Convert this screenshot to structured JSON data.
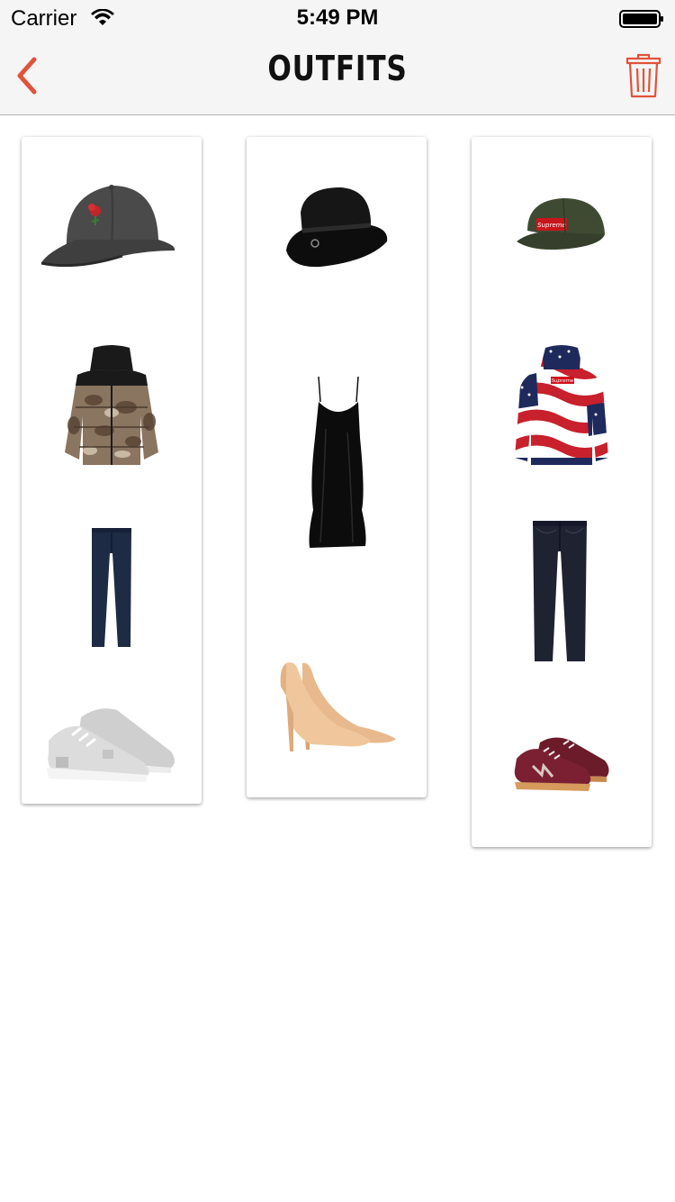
{
  "status_bar": {
    "carrier": "Carrier",
    "time": "5:49 PM"
  },
  "nav": {
    "title": "OUTFITS",
    "back_icon": "chevron-left-icon",
    "delete_icon": "trash-icon"
  },
  "colors": {
    "accent": "#e0533a",
    "bar_background": "#f5f5f5"
  },
  "outfits": [
    {
      "items": [
        "rose-embroidered-cap",
        "puffer-jacket",
        "navy-pants",
        "grey-sneakers"
      ]
    },
    {
      "items": [
        "black-wide-brim-hat",
        "black-slip-dress",
        "nude-heels"
      ]
    },
    {
      "items": [
        "green-camp-cap",
        "flag-hoodie",
        "dark-jeans",
        "burgundy-sneakers"
      ]
    }
  ]
}
